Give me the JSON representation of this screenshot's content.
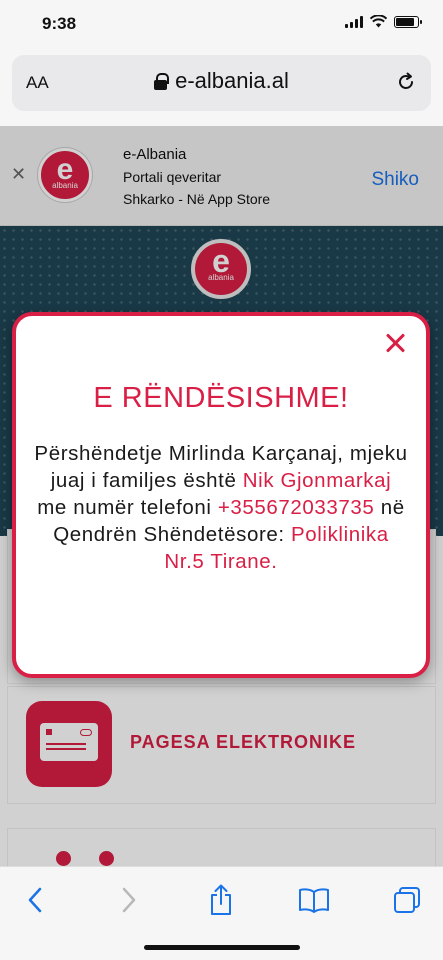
{
  "status": {
    "time": "9:38",
    "battery_level": 0.85
  },
  "browser": {
    "text_size_label": "AA",
    "url": "e-albania.al"
  },
  "app_banner": {
    "title": "e-Albania",
    "subtitle": "Portali qeveritar",
    "store_text": "Shkarko - Në App Store",
    "action": "Shiko",
    "logo_letter": "e",
    "logo_sub": "albania"
  },
  "page": {
    "menu_items": [
      {
        "label": "PAGESA ELEKTRONIKE"
      }
    ]
  },
  "modal": {
    "title": "E RËNDËSISHME!",
    "body_greeting": "Përshëndetje Mirlinda Karçanaj, mjeku juaj i familjes është",
    "doctor_name": "Nik Gjonmarkaj",
    "body_mid": "me numër telefoni",
    "phone": "+355672033735",
    "body_center": "në Qendrën Shëndetësore:",
    "health_center": "Poliklinika Nr.5 Tirane."
  },
  "colors": {
    "accent": "#d91f45",
    "hero_bg": "#1f4657",
    "link_blue": "#1a73e8"
  }
}
